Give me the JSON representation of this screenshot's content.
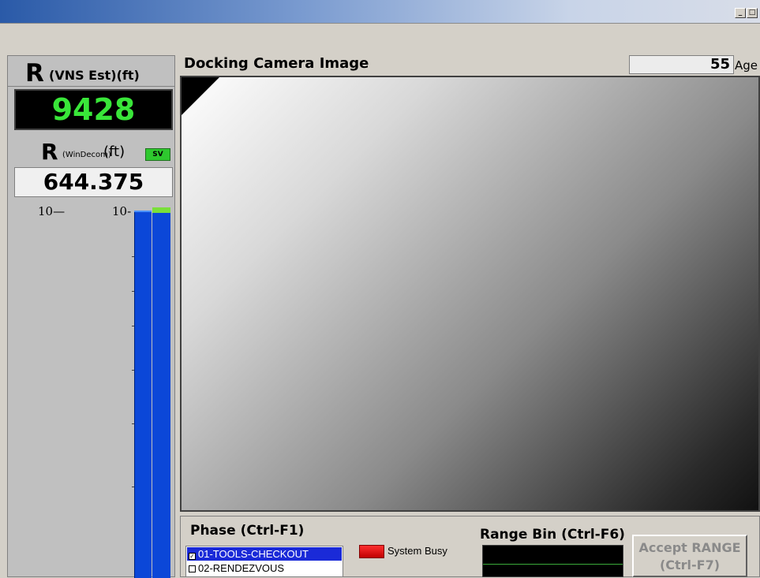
{
  "window": {
    "minimize_label": "_",
    "maximize_label": "□"
  },
  "range_panel": {
    "r_letter": "R",
    "vns_label": "(VNS Est)(ft)",
    "vns_value": "9428",
    "r2_letter": "R",
    "windecom_label": "(WinDecom)",
    "ft_label": "(ft)",
    "sv_badge": "SV",
    "windecom_value": "644.375",
    "scale_left": "10—",
    "scale_right": "10-",
    "colors": {
      "vns_value": "#39e639",
      "bar": "#0b47d8",
      "bar_cap": "#7adf3a"
    }
  },
  "camera": {
    "title": "Docking Camera Image",
    "age_value": "55",
    "age_label": "Age"
  },
  "phase": {
    "title": "Phase (Ctrl-F1)",
    "items": [
      {
        "label": "01-TOOLS-CHECKOUT",
        "checked": true,
        "selected": true
      },
      {
        "label": "02-RENDEZVOUS",
        "checked": false,
        "selected": false
      }
    ]
  },
  "status": {
    "busy_label": "System Busy",
    "busy_color": "#ff0000"
  },
  "range_bin": {
    "title": "Range Bin (Ctrl-F6)"
  },
  "accept": {
    "line1": "Accept RANGE",
    "line2": "(Ctrl-F7)"
  }
}
